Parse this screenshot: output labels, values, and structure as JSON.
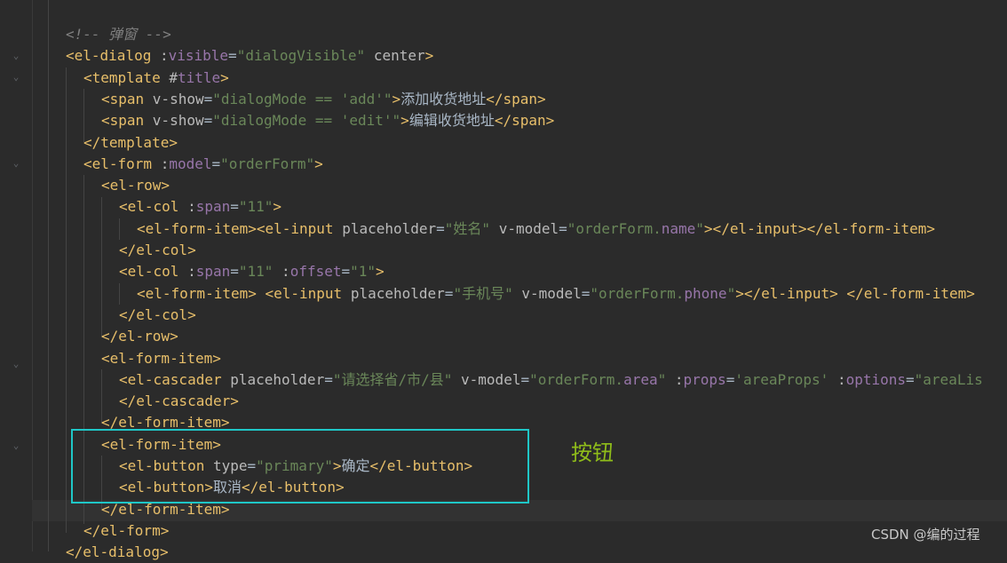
{
  "editor": {
    "lines": [
      [
        {
          "c": "comment",
          "t": "<!-- 弹窗 -->"
        }
      ],
      [
        {
          "c": "tag",
          "t": "<el-dialog "
        },
        {
          "c": "colon",
          "t": ":"
        },
        {
          "c": "vattr",
          "t": "visible"
        },
        {
          "c": "txt",
          "t": "="
        },
        {
          "c": "str",
          "t": "\"dialogVisible\""
        },
        {
          "c": "attr",
          "t": " center"
        },
        {
          "c": "tag",
          "t": ">"
        }
      ],
      [
        {
          "c": "tag",
          "t": "<template "
        },
        {
          "c": "attr",
          "t": "#"
        },
        {
          "c": "vattr",
          "t": "title"
        },
        {
          "c": "tag",
          "t": ">"
        }
      ],
      [
        {
          "c": "tag",
          "t": "<span "
        },
        {
          "c": "attr",
          "t": "v-show"
        },
        {
          "c": "txt",
          "t": "="
        },
        {
          "c": "str",
          "t": "\"dialogMode == "
        },
        {
          "c": "sq",
          "t": "'add'"
        },
        {
          "c": "str",
          "t": "\""
        },
        {
          "c": "tag",
          "t": ">"
        },
        {
          "c": "txt cjk",
          "t": "添加收货地址"
        },
        {
          "c": "tag",
          "t": "</span>"
        }
      ],
      [
        {
          "c": "tag",
          "t": "<span "
        },
        {
          "c": "attr",
          "t": "v-show"
        },
        {
          "c": "txt",
          "t": "="
        },
        {
          "c": "str",
          "t": "\"dialogMode == "
        },
        {
          "c": "sq",
          "t": "'edit'"
        },
        {
          "c": "str",
          "t": "\""
        },
        {
          "c": "tag",
          "t": ">"
        },
        {
          "c": "txt cjk",
          "t": "编辑收货地址"
        },
        {
          "c": "tag",
          "t": "</span>"
        }
      ],
      [
        {
          "c": "tag",
          "t": "</template>"
        }
      ],
      [
        {
          "c": "tag",
          "t": "<el-form "
        },
        {
          "c": "colon",
          "t": ":"
        },
        {
          "c": "vattr",
          "t": "model"
        },
        {
          "c": "txt",
          "t": "="
        },
        {
          "c": "str",
          "t": "\"orderForm\""
        },
        {
          "c": "tag",
          "t": ">"
        }
      ],
      [
        {
          "c": "tag",
          "t": "<el-row>"
        }
      ],
      [
        {
          "c": "tag",
          "t": "<el-col "
        },
        {
          "c": "colon",
          "t": ":"
        },
        {
          "c": "vattr",
          "t": "span"
        },
        {
          "c": "txt",
          "t": "="
        },
        {
          "c": "str",
          "t": "\"11\""
        },
        {
          "c": "tag",
          "t": ">"
        }
      ],
      [
        {
          "c": "tag",
          "t": "<el-form-item><el-input "
        },
        {
          "c": "attr",
          "t": "placeholder"
        },
        {
          "c": "txt",
          "t": "="
        },
        {
          "c": "str",
          "t": "\"姓名\""
        },
        {
          "c": "attr",
          "t": " v-model"
        },
        {
          "c": "txt",
          "t": "="
        },
        {
          "c": "str",
          "t": "\"orderForm."
        },
        {
          "c": "vattr",
          "t": "name"
        },
        {
          "c": "str",
          "t": "\""
        },
        {
          "c": "tag",
          "t": "></el-input></el-form-item>"
        }
      ],
      [
        {
          "c": "tag",
          "t": "</el-col>"
        }
      ],
      [
        {
          "c": "tag",
          "t": "<el-col "
        },
        {
          "c": "colon",
          "t": ":"
        },
        {
          "c": "vattr",
          "t": "span"
        },
        {
          "c": "txt",
          "t": "="
        },
        {
          "c": "str",
          "t": "\"11\""
        },
        {
          "c": "txt",
          "t": " "
        },
        {
          "c": "colon",
          "t": ":"
        },
        {
          "c": "vattr",
          "t": "offset"
        },
        {
          "c": "txt",
          "t": "="
        },
        {
          "c": "str",
          "t": "\"1\""
        },
        {
          "c": "tag",
          "t": ">"
        }
      ],
      [
        {
          "c": "tag",
          "t": "<el-form-item> <el-input "
        },
        {
          "c": "attr",
          "t": "placeholder"
        },
        {
          "c": "txt",
          "t": "="
        },
        {
          "c": "str",
          "t": "\"手机号\""
        },
        {
          "c": "attr",
          "t": " v-model"
        },
        {
          "c": "txt",
          "t": "="
        },
        {
          "c": "str",
          "t": "\"orderForm."
        },
        {
          "c": "vattr",
          "t": "phone"
        },
        {
          "c": "str",
          "t": "\""
        },
        {
          "c": "tag",
          "t": "></el-input> </el-form-item>"
        }
      ],
      [
        {
          "c": "tag",
          "t": "</el-col>"
        }
      ],
      [
        {
          "c": "tag",
          "t": "</el-row>"
        }
      ],
      [
        {
          "c": "tag",
          "t": "<el-form-item>"
        }
      ],
      [
        {
          "c": "tag",
          "t": "<el-cascader "
        },
        {
          "c": "attr",
          "t": "placeholder"
        },
        {
          "c": "txt",
          "t": "="
        },
        {
          "c": "str",
          "t": "\"请选择省/市/县\""
        },
        {
          "c": "attr",
          "t": " v-model"
        },
        {
          "c": "txt",
          "t": "="
        },
        {
          "c": "str",
          "t": "\"orderForm."
        },
        {
          "c": "vattr",
          "t": "area"
        },
        {
          "c": "str",
          "t": "\""
        },
        {
          "c": "txt",
          "t": " "
        },
        {
          "c": "colon",
          "t": ":"
        },
        {
          "c": "vattr",
          "t": "props"
        },
        {
          "c": "txt",
          "t": "="
        },
        {
          "c": "sq",
          "t": "'areaProps'"
        },
        {
          "c": "txt",
          "t": " "
        },
        {
          "c": "colon",
          "t": ":"
        },
        {
          "c": "vattr",
          "t": "options"
        },
        {
          "c": "txt",
          "t": "="
        },
        {
          "c": "str",
          "t": "\"areaLis"
        }
      ],
      [
        {
          "c": "tag",
          "t": "</el-cascader>"
        }
      ],
      [
        {
          "c": "tag",
          "t": "</el-form-item>"
        }
      ],
      [
        {
          "c": "tag",
          "t": "<el-form-item>"
        }
      ],
      [
        {
          "c": "tag",
          "t": "<el-button "
        },
        {
          "c": "attr",
          "t": "type"
        },
        {
          "c": "txt",
          "t": "="
        },
        {
          "c": "str",
          "t": "\"primary\""
        },
        {
          "c": "tag",
          "t": ">"
        },
        {
          "c": "txt cjk",
          "t": "确定"
        },
        {
          "c": "tag",
          "t": "</el-button>"
        }
      ],
      [
        {
          "c": "tag",
          "t": "<el-button>"
        },
        {
          "c": "txt cjk",
          "t": "取消"
        },
        {
          "c": "tag",
          "t": "</el-button>"
        }
      ],
      [
        {
          "c": "tag",
          "t": "</el-form-item>"
        }
      ],
      [
        {
          "c": "tag",
          "t": "</el-form>"
        }
      ],
      [
        {
          "c": "tag",
          "t": "</el-dialog>"
        }
      ]
    ]
  },
  "annotation": {
    "label": "按钮"
  },
  "watermark": {
    "text": "CSDN @编的过程"
  },
  "colors": {
    "background": "#2b2b2b",
    "tag": "#e8bf6a",
    "attribute": "#bababa",
    "vue_binding": "#9876aa",
    "string": "#6a8759",
    "comment": "#808080",
    "highlight_box": "#1fc7c7",
    "annotation_text": "#8fbc1a"
  }
}
